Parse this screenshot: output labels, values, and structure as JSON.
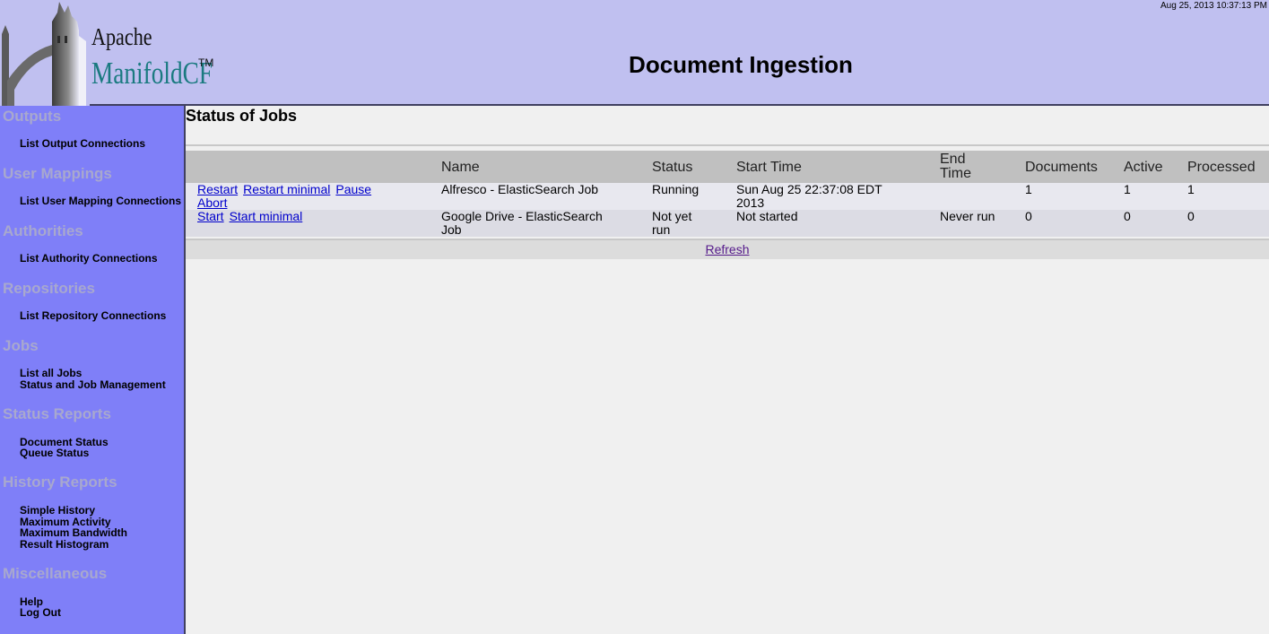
{
  "header": {
    "logo_apache": "Apache",
    "logo_manifold": "ManifoldCF",
    "logo_tm": "TM",
    "title": "Document Ingestion",
    "timestamp": "Aug 25, 2013 10:37:13 PM"
  },
  "sidebar": {
    "outputs": {
      "title": "Outputs",
      "items": [
        "List Output Connections"
      ]
    },
    "user_mappings": {
      "title": "User Mappings",
      "items": [
        "List User Mapping Connections"
      ]
    },
    "authorities": {
      "title": "Authorities",
      "items": [
        "List Authority Connections"
      ]
    },
    "repositories": {
      "title": "Repositories",
      "items": [
        "List Repository Connections"
      ]
    },
    "jobs": {
      "title": "Jobs",
      "items": [
        "List all Jobs",
        "Status and Job Management"
      ]
    },
    "status_reports": {
      "title": "Status Reports",
      "items": [
        "Document Status",
        "Queue Status"
      ]
    },
    "history_reports": {
      "title": "History Reports",
      "items": [
        "Simple History",
        "Maximum Activity",
        "Maximum Bandwidth",
        "Result Histogram"
      ]
    },
    "misc": {
      "title": "Miscellaneous",
      "items": [
        "Help",
        "Log Out"
      ]
    }
  },
  "main": {
    "title": "Status of Jobs",
    "columns": {
      "name": "Name",
      "status": "Status",
      "start_time": "Start Time",
      "end_time_1": "End",
      "end_time_2": "Time",
      "documents": "Documents",
      "active": "Active",
      "processed": "Processed"
    },
    "rows": [
      {
        "actions": [
          "Restart",
          "Restart minimal",
          "Pause",
          "Abort"
        ],
        "name": "Alfresco - ElasticSearch Job",
        "status": "Running",
        "start_time_1": "Sun Aug 25 22:37:08 EDT",
        "start_time_2": "2013",
        "end_time": "",
        "documents": "1",
        "active": "1",
        "processed": "1"
      },
      {
        "actions": [
          "Start",
          "Start minimal"
        ],
        "name_1": "Google Drive - ElasticSearch",
        "name_2": "Job",
        "status_1": "Not yet",
        "status_2": "run",
        "start_time": "Not started",
        "end_time": "Never run",
        "documents": "0",
        "active": "0",
        "processed": "0"
      }
    ],
    "refresh": "Refresh"
  }
}
